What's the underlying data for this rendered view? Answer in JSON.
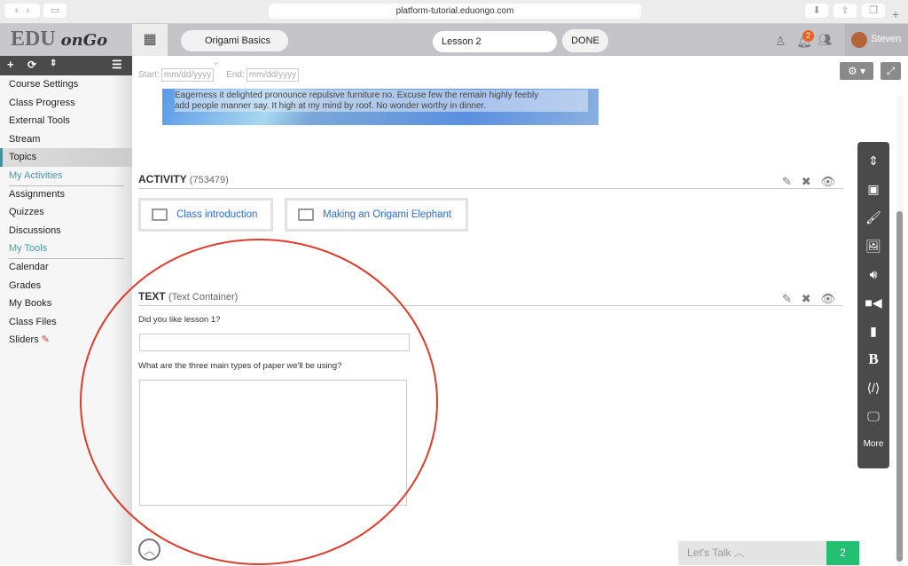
{
  "browser": {
    "url": "platform-tutorial.eduongo.com"
  },
  "header": {
    "logo_main": "EDU",
    "logo_script": "onGo",
    "course": "Origami Basics",
    "lesson": "Lesson 2",
    "done": "DONE",
    "notifications": "2",
    "user": "Steven"
  },
  "sidebar": {
    "items": [
      {
        "label": "Course Settings"
      },
      {
        "label": "Class Progress"
      },
      {
        "label": "External Tools"
      },
      {
        "label": "Stream"
      },
      {
        "label": "Topics",
        "active": true
      },
      {
        "label": "My Activities",
        "group": true
      },
      {
        "label": "Assignments"
      },
      {
        "label": "Quizzes"
      },
      {
        "label": "Discussions"
      },
      {
        "label": "My Tools",
        "group": true
      },
      {
        "label": "Calendar"
      },
      {
        "label": "Grades"
      },
      {
        "label": "My Books"
      },
      {
        "label": "Class Files"
      },
      {
        "label": "Sliders"
      }
    ]
  },
  "dates": {
    "start_label": "Start:",
    "start_ph": "mm/dd/yyyy",
    "end_label": "End:",
    "end_ph": "mm/dd/yyyy"
  },
  "banner": {
    "line1": "Eagerness it delighted pronounce repulsive furniture no. Excuse few the remain highly feebly",
    "line2": "add people manner say. It high at my mind by roof. No wonder worthy in dinner."
  },
  "activity": {
    "title": "ACTIVITY",
    "id": "(753479)",
    "items": [
      "Class introduction",
      "Making an Origami Elephant"
    ]
  },
  "text": {
    "title": "TEXT",
    "subtitle": "(Text Container)",
    "q1": "Did you like lesson 1?",
    "q2": "What are the three main types of paper we'll be using?"
  },
  "toolbar": {
    "more": "More"
  },
  "chat": {
    "label": "Let's Talk",
    "count": "2"
  },
  "colors": {
    "accent": "#2a6dd8",
    "annotation": "#e03a2a",
    "chat_badge": "#22c070",
    "notification": "#e8641e"
  }
}
